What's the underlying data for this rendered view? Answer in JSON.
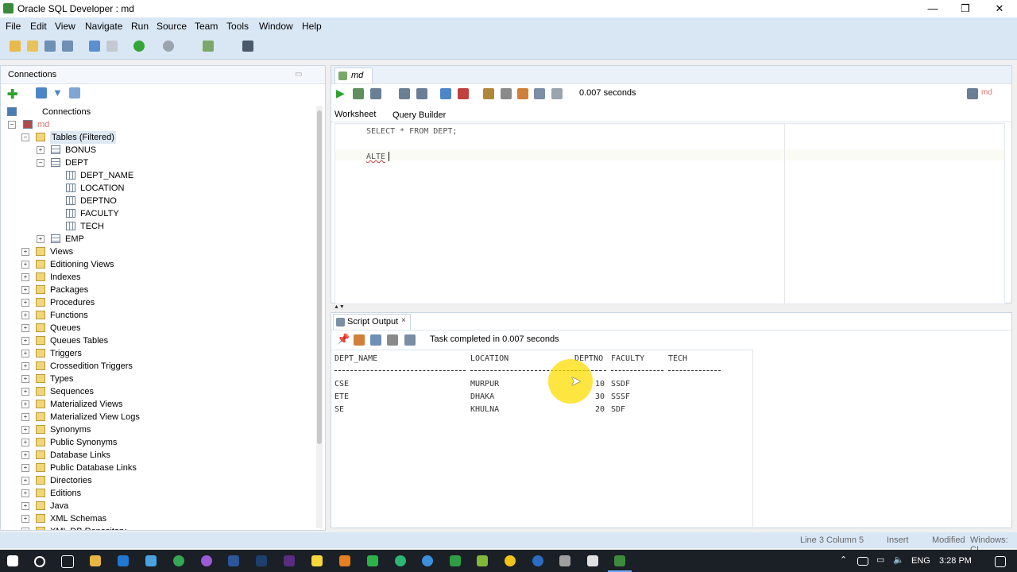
{
  "window": {
    "title": "Oracle SQL Developer : md"
  },
  "menu": [
    "File",
    "Edit",
    "View",
    "Navigate",
    "Run",
    "Source",
    "Team",
    "Tools",
    "Window",
    "Help"
  ],
  "connections": {
    "panel_title": "Connections",
    "root_label": "Connections",
    "connection_name": "md",
    "tree": [
      {
        "label": "Tables (Filtered)",
        "level": 1,
        "icon": "folder",
        "expanded": true
      },
      {
        "label": "BONUS",
        "level": 2,
        "icon": "table",
        "expanded": false
      },
      {
        "label": "DEPT",
        "level": 2,
        "icon": "table",
        "expanded": true
      },
      {
        "label": "DEPT_NAME",
        "level": 3,
        "icon": "col"
      },
      {
        "label": "LOCATION",
        "level": 3,
        "icon": "col"
      },
      {
        "label": "DEPTNO",
        "level": 3,
        "icon": "col"
      },
      {
        "label": "FACULTY",
        "level": 3,
        "icon": "col"
      },
      {
        "label": "TECH",
        "level": 3,
        "icon": "col"
      },
      {
        "label": "EMP",
        "level": 2,
        "icon": "table",
        "expanded": false
      },
      {
        "label": "Views",
        "level": 1,
        "icon": "folder"
      },
      {
        "label": "Editioning Views",
        "level": 1,
        "icon": "folder"
      },
      {
        "label": "Indexes",
        "level": 1,
        "icon": "folder"
      },
      {
        "label": "Packages",
        "level": 1,
        "icon": "folder"
      },
      {
        "label": "Procedures",
        "level": 1,
        "icon": "folder"
      },
      {
        "label": "Functions",
        "level": 1,
        "icon": "folder"
      },
      {
        "label": "Queues",
        "level": 1,
        "icon": "folder"
      },
      {
        "label": "Queues Tables",
        "level": 1,
        "icon": "folder"
      },
      {
        "label": "Triggers",
        "level": 1,
        "icon": "folder"
      },
      {
        "label": "Crossedition Triggers",
        "level": 1,
        "icon": "folder"
      },
      {
        "label": "Types",
        "level": 1,
        "icon": "folder"
      },
      {
        "label": "Sequences",
        "level": 1,
        "icon": "folder"
      },
      {
        "label": "Materialized Views",
        "level": 1,
        "icon": "folder"
      },
      {
        "label": "Materialized View Logs",
        "level": 1,
        "icon": "folder"
      },
      {
        "label": "Synonyms",
        "level": 1,
        "icon": "folder"
      },
      {
        "label": "Public Synonyms",
        "level": 1,
        "icon": "folder"
      },
      {
        "label": "Database Links",
        "level": 1,
        "icon": "folder"
      },
      {
        "label": "Public Database Links",
        "level": 1,
        "icon": "folder"
      },
      {
        "label": "Directories",
        "level": 1,
        "icon": "folder"
      },
      {
        "label": "Editions",
        "level": 1,
        "icon": "folder"
      },
      {
        "label": "Java",
        "level": 1,
        "icon": "folder"
      },
      {
        "label": "XML Schemas",
        "level": 1,
        "icon": "folder"
      },
      {
        "label": "XML DB Repository",
        "level": 1,
        "icon": "folder"
      }
    ]
  },
  "editor": {
    "doc_tab": "md",
    "elapsed": "0.007 seconds",
    "tabs": [
      "Worksheet",
      "Query Builder"
    ],
    "lines": [
      "SELECT * FROM DEPT;",
      "",
      "ALTE"
    ],
    "connection_selector": "md"
  },
  "output": {
    "tab_label": "Script Output",
    "task_status": "Task completed in 0.007 seconds",
    "headers": [
      "DEPT_NAME",
      "LOCATION",
      "DEPTNO",
      "FACULTY",
      "TECH"
    ],
    "rows": [
      [
        "CSE",
        "MURPUR",
        "10",
        "SSDF",
        ""
      ],
      [
        "ETE",
        "DHAKA",
        "30",
        "SSSF",
        ""
      ],
      [
        "SE",
        "KHULNA",
        "20",
        "SDF",
        ""
      ]
    ]
  },
  "status": {
    "position": "Line 3 Column 5",
    "mode": "Insert",
    "modified": "Modified",
    "line_end": "Windows: CI"
  },
  "taskbar": {
    "lang": "ENG",
    "time": "3:28 PM"
  }
}
